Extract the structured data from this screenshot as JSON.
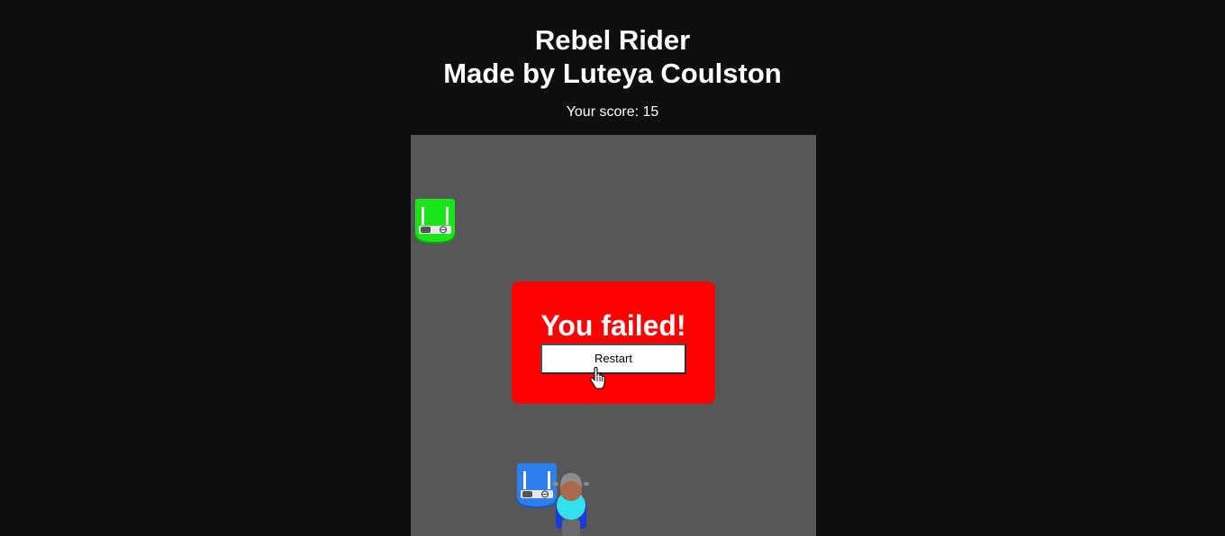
{
  "header": {
    "title_line1": "Rebel Rider",
    "title_line2": "Made by Luteya Coulston",
    "score_label": "Your score: 15"
  },
  "game": {
    "colors": {
      "page_background": "#0d0f0e",
      "road": "#575757",
      "dialog": "#ff0000",
      "enemy_car": "#19e619",
      "parked_car": "#2f7ef0",
      "rider_shirt": "#33e0f0",
      "rider_pants": "#1d3ad8"
    },
    "entities": [
      "green-car",
      "blue-car",
      "motorcycle-rider"
    ]
  },
  "dialog": {
    "title": "You failed!",
    "restart_label": "Restart"
  },
  "cursor": {
    "icon": "hand-pointer-icon"
  }
}
